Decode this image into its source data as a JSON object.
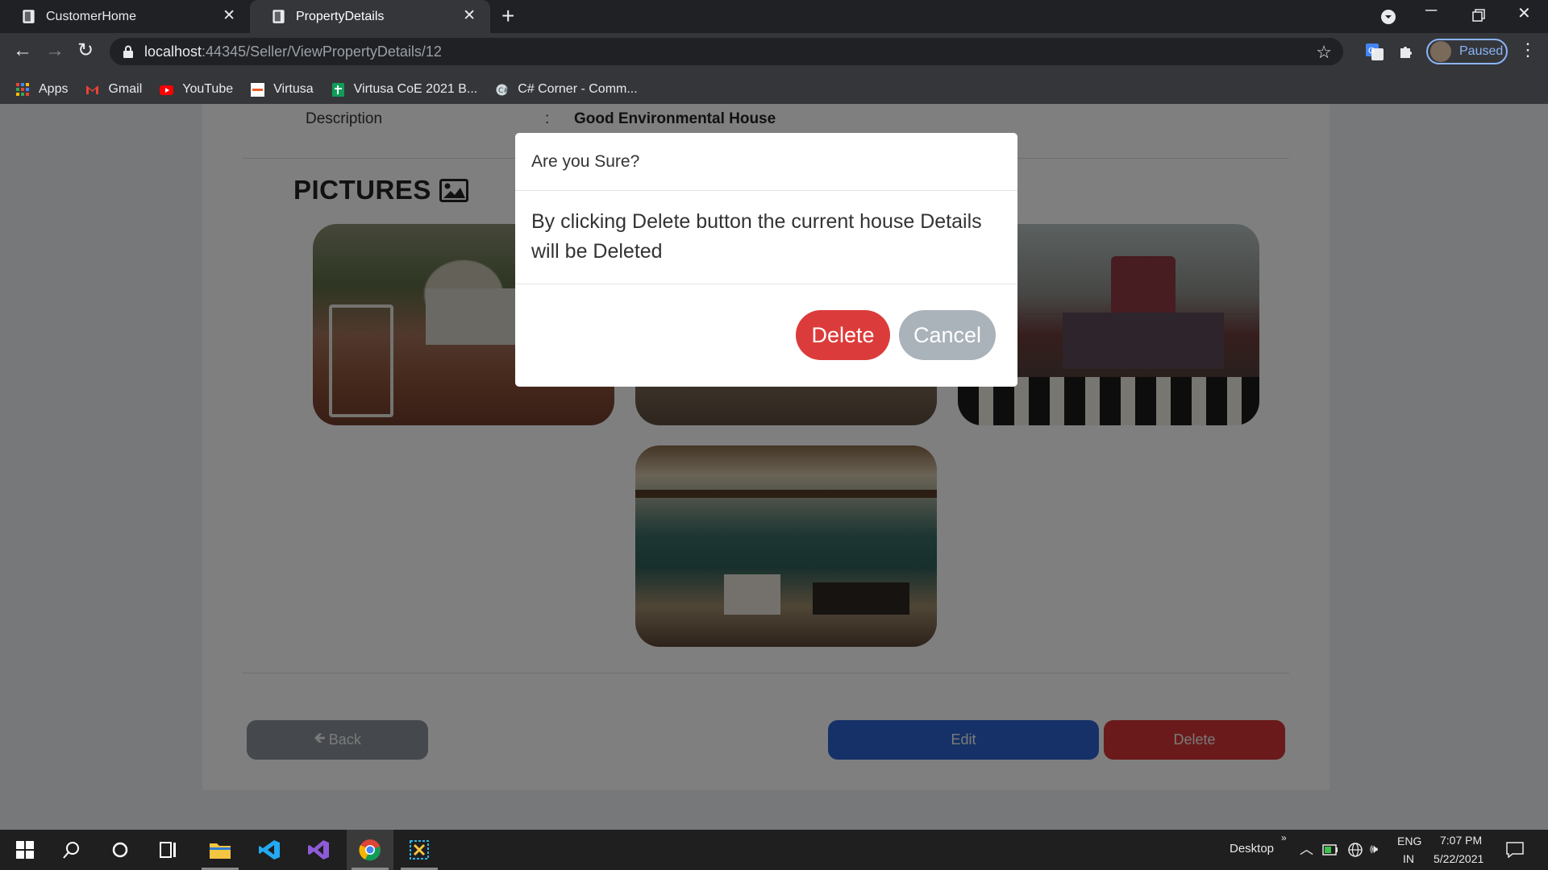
{
  "browser": {
    "tabs": [
      {
        "title": "CustomerHome",
        "active": false
      },
      {
        "title": "PropertyDetails",
        "active": true
      }
    ],
    "url_host": "localhost",
    "url_rest": ":44345/Seller/ViewPropertyDetails/12",
    "profile_label": "Paused",
    "bookmarks": [
      {
        "label": "Apps",
        "icon": "apps-grid-icon"
      },
      {
        "label": "Gmail",
        "icon": "gmail-icon"
      },
      {
        "label": "YouTube",
        "icon": "youtube-icon"
      },
      {
        "label": "Virtusa",
        "icon": "virtusa-icon"
      },
      {
        "label": "Virtusa CoE 2021 B...",
        "icon": "sheets-icon"
      },
      {
        "label": "C# Corner - Comm...",
        "icon": "csharp-corner-icon"
      }
    ]
  },
  "page": {
    "description_label": "Description",
    "description_colon": ":",
    "description_value": "Good Environmental House",
    "pictures_heading": "PICTURES",
    "buttons": {
      "back": "Back",
      "edit": "Edit",
      "delete": "Delete"
    }
  },
  "modal": {
    "title": "Are you Sure?",
    "body": "By clicking Delete button the current house Details will be Deleted",
    "delete_label": "Delete",
    "cancel_label": "Cancel"
  },
  "taskbar": {
    "desktop_label": "Desktop",
    "lang_top": "ENG",
    "lang_bottom": "IN",
    "time": "7:07 PM",
    "date": "5/22/2021"
  },
  "colors": {
    "delete_red": "#dc3b3b",
    "edit_blue": "#2d63d1",
    "cancel_gray": "#aab2ba"
  }
}
